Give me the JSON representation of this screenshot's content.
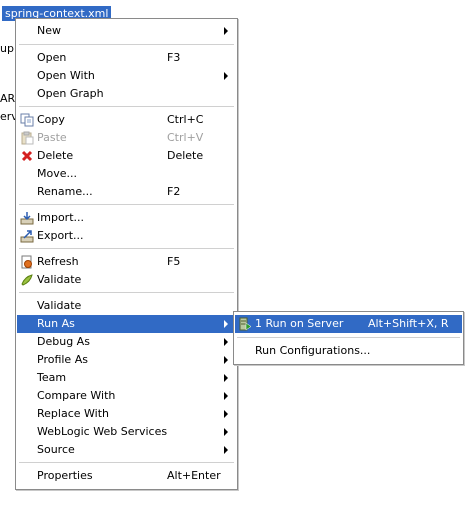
{
  "selected_file": "spring-context.xml",
  "background_fragments": [
    "upp",
    "AR",
    "erv"
  ],
  "context_menu": {
    "items": [
      {
        "label": "New",
        "shortcut": "",
        "submenu": true
      },
      {
        "label": "Open",
        "shortcut": "F3"
      },
      {
        "label": "Open With",
        "shortcut": "",
        "submenu": true
      },
      {
        "label": "Open Graph",
        "shortcut": ""
      },
      {
        "label": "Copy",
        "shortcut": "Ctrl+C",
        "icon": "copy-icon"
      },
      {
        "label": "Paste",
        "shortcut": "Ctrl+V",
        "icon": "paste-icon",
        "disabled": true
      },
      {
        "label": "Delete",
        "shortcut": "Delete",
        "icon": "delete-icon"
      },
      {
        "label": "Move...",
        "shortcut": ""
      },
      {
        "label": "Rename...",
        "shortcut": "F2"
      },
      {
        "label": "Import...",
        "shortcut": "",
        "icon": "import-icon"
      },
      {
        "label": "Export...",
        "shortcut": "",
        "icon": "export-icon"
      },
      {
        "label": "Refresh",
        "shortcut": "F5",
        "icon": "refresh-icon"
      },
      {
        "label": "Validate",
        "shortcut": "",
        "icon": "validate-icon"
      },
      {
        "label": "Validate",
        "shortcut": ""
      },
      {
        "label": "Run As",
        "shortcut": "",
        "submenu": true,
        "highlighted": true
      },
      {
        "label": "Debug As",
        "shortcut": "",
        "submenu": true
      },
      {
        "label": "Profile As",
        "shortcut": "",
        "submenu": true
      },
      {
        "label": "Team",
        "shortcut": "",
        "submenu": true
      },
      {
        "label": "Compare With",
        "shortcut": "",
        "submenu": true
      },
      {
        "label": "Replace With",
        "shortcut": "",
        "submenu": true
      },
      {
        "label": "WebLogic Web Services",
        "shortcut": "",
        "submenu": true
      },
      {
        "label": "Source",
        "shortcut": "",
        "submenu": true
      },
      {
        "label": "Properties",
        "shortcut": "Alt+Enter"
      }
    ]
  },
  "run_as_submenu": {
    "items": [
      {
        "label": "1 Run on Server",
        "shortcut": "Alt+Shift+X, R",
        "icon": "run-server-icon"
      },
      {
        "label": "Run Configurations...",
        "shortcut": ""
      }
    ]
  },
  "colors": {
    "highlight": "#316ac5",
    "disabled_text": "#a0a0a0",
    "border": "#8a8a8a"
  }
}
